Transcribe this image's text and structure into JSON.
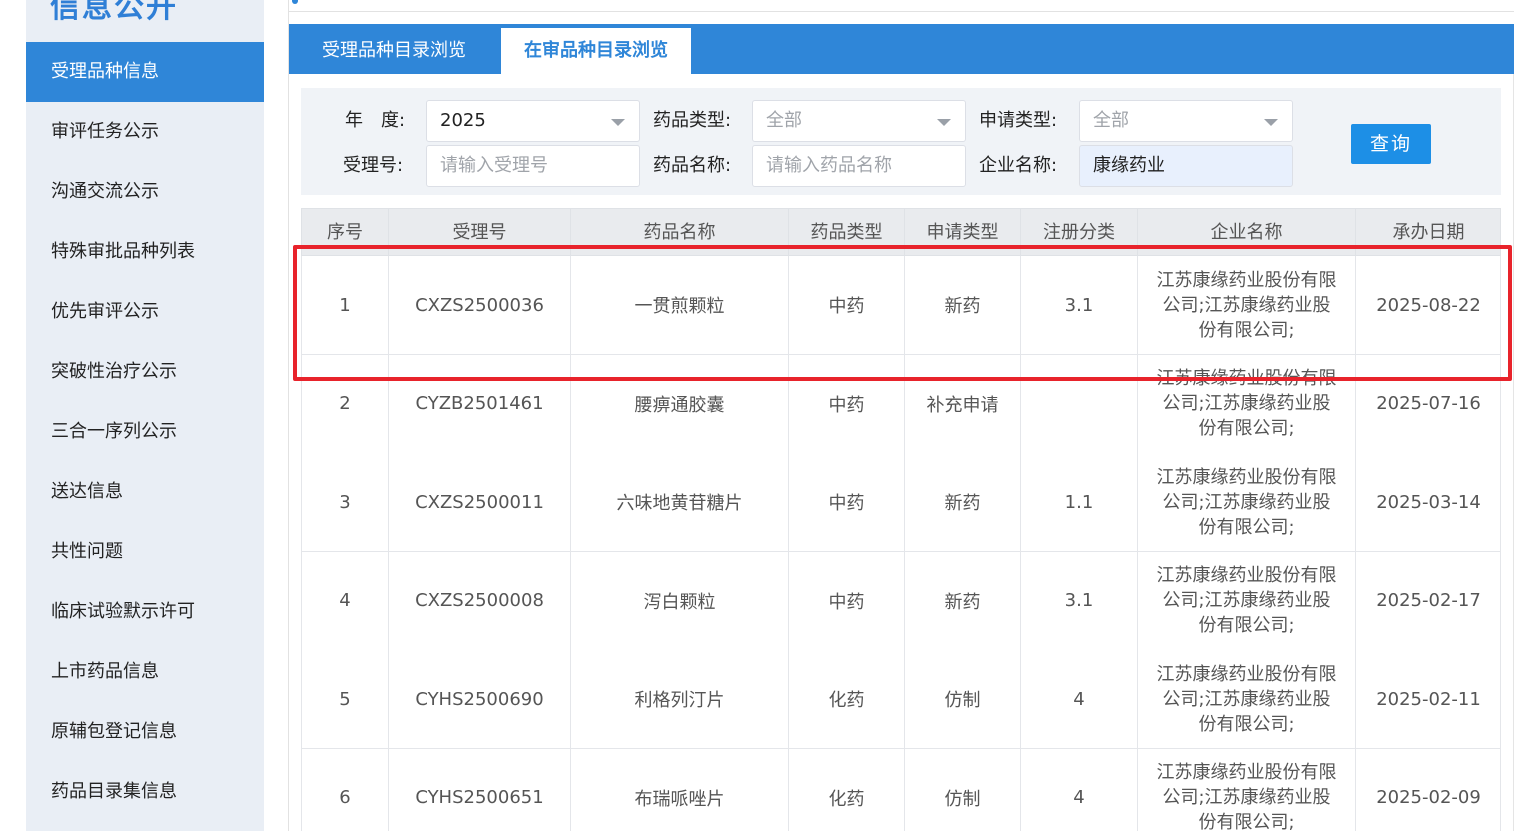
{
  "sidebar": {
    "title": "信息公开",
    "items": [
      {
        "label": "受理品种信息",
        "active": true
      },
      {
        "label": "审评任务公示"
      },
      {
        "label": "沟通交流公示"
      },
      {
        "label": "特殊审批品种列表"
      },
      {
        "label": "优先审评公示"
      },
      {
        "label": "突破性治疗公示"
      },
      {
        "label": "三合一序列公示"
      },
      {
        "label": "送达信息"
      },
      {
        "label": "共性问题"
      },
      {
        "label": "临床试验默示许可"
      },
      {
        "label": "上市药品信息"
      },
      {
        "label": "原辅包登记信息"
      },
      {
        "label": "药品目录集信息"
      }
    ]
  },
  "tabs": [
    {
      "label": "受理品种目录浏览",
      "active": false
    },
    {
      "label": "在审品种目录浏览",
      "active": true
    }
  ],
  "filter": {
    "year_label": "年　度:",
    "year_value": "2025",
    "drug_type_label": "药品类型:",
    "drug_type_value": "全部",
    "apply_type_label": "申请类型:",
    "apply_type_value": "全部",
    "accept_no_label": "受理号:",
    "accept_no_placeholder": "请输入受理号",
    "drug_name_label": "药品名称:",
    "drug_name_placeholder": "请输入药品名称",
    "company_label": "企业名称:",
    "company_value": "康缘药业",
    "query_button": "查询"
  },
  "table": {
    "headers": [
      "序号",
      "受理号",
      "药品名称",
      "药品类型",
      "申请类型",
      "注册分类",
      "企业名称",
      "承办日期"
    ],
    "rows": [
      {
        "no": "1",
        "accept_no": "CXZS2500036",
        "drug_name": "一贯煎颗粒",
        "drug_type": "中药",
        "apply_type": "新药",
        "reg_class": "3.1",
        "company": "江苏康缘药业股份有限公司;江苏康缘药业股份有限公司;",
        "date": "2025-08-22"
      },
      {
        "no": "2",
        "accept_no": "CYZB2501461",
        "drug_name": "腰痹通胶囊",
        "drug_type": "中药",
        "apply_type": "补充申请",
        "reg_class": "",
        "company": "江苏康缘药业股份有限公司;江苏康缘药业股份有限公司;",
        "date": "2025-07-16"
      },
      {
        "no": "3",
        "accept_no": "CXZS2500011",
        "drug_name": "六味地黄苷糖片",
        "drug_type": "中药",
        "apply_type": "新药",
        "reg_class": "1.1",
        "company": "江苏康缘药业股份有限公司;江苏康缘药业股份有限公司;",
        "date": "2025-03-14"
      },
      {
        "no": "4",
        "accept_no": "CXZS2500008",
        "drug_name": "泻白颗粒",
        "drug_type": "中药",
        "apply_type": "新药",
        "reg_class": "3.1",
        "company": "江苏康缘药业股份有限公司;江苏康缘药业股份有限公司;",
        "date": "2025-02-17"
      },
      {
        "no": "5",
        "accept_no": "CYHS2500690",
        "drug_name": "利格列汀片",
        "drug_type": "化药",
        "apply_type": "仿制",
        "reg_class": "4",
        "company": "江苏康缘药业股份有限公司;江苏康缘药业股份有限公司;",
        "date": "2025-02-11"
      },
      {
        "no": "6",
        "accept_no": "CYHS2500651",
        "drug_name": "布瑞哌唑片",
        "drug_type": "化药",
        "apply_type": "仿制",
        "reg_class": "4",
        "company": "江苏康缘药业股份有限公司;江苏康缘药业股份有限公司;",
        "date": "2025-02-09"
      }
    ]
  },
  "colors": {
    "primary": "#2f86d8",
    "highlight_box": "#e8232b"
  }
}
